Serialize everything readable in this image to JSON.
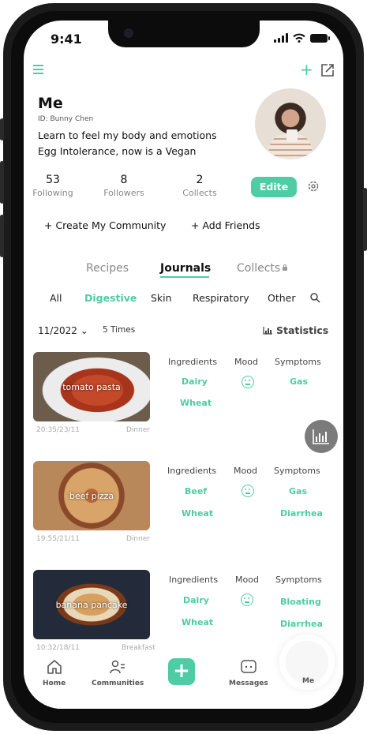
{
  "status_bar": {
    "time": "9:41"
  },
  "profile": {
    "name": "Me",
    "id_line": "ID: Bunny Chen",
    "bio_line1": "Learn to feel my body and emotions",
    "bio_line2": "Egg Intolerance, now is a Vegan"
  },
  "stats": [
    {
      "value": "53",
      "label": "Following"
    },
    {
      "value": "8",
      "label": "Followers"
    },
    {
      "value": "2",
      "label": "Collects"
    }
  ],
  "edit_button": "Edite",
  "actions": {
    "create_community": "+ Create My Community",
    "add_friends": "+ Add Friends"
  },
  "tabs": [
    "Recipes",
    "Journals",
    "Collects"
  ],
  "active_tab": "Journals",
  "filters": [
    "All",
    "Digestive",
    "Skin",
    "Respiratory",
    "Other"
  ],
  "active_filter": "Digestive",
  "summary": {
    "month": "11/2022",
    "times": "5 Times",
    "statistics": "Statistics"
  },
  "columns": {
    "ingredients": "Ingredients",
    "mood": "Mood",
    "symptoms": "Symptoms"
  },
  "entries": [
    {
      "title": "tomato pasta",
      "time": "20:35/23/11",
      "meal": "Dinner",
      "ingredients": [
        "Dairy",
        "Wheat"
      ],
      "symptoms": [
        "Gas"
      ]
    },
    {
      "title": "beef pizza",
      "time": "19:55/21/11",
      "meal": "Dinner",
      "ingredients": [
        "Beef",
        "Wheat"
      ],
      "symptoms": [
        "Gas",
        "Diarrhea"
      ]
    },
    {
      "title": "banana pancake",
      "time": "10:32/18/11",
      "meal": "Breakfast",
      "ingredients": [
        "Dairy",
        "Wheat"
      ],
      "symptoms": [
        "Bloating",
        "Diarrhea"
      ]
    }
  ],
  "nav": {
    "home": "Home",
    "communities": "Communities",
    "messages": "Messages",
    "me": "Me"
  },
  "colors": {
    "accent": "#4ecca3",
    "text": "#111111",
    "muted": "#888888"
  }
}
